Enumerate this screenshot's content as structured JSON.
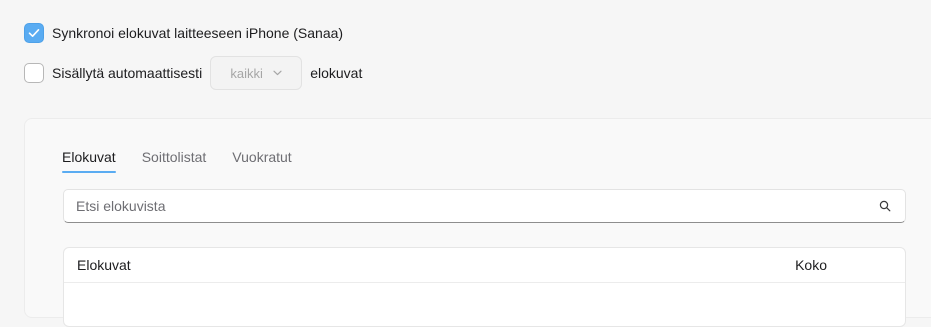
{
  "sync": {
    "checked": true,
    "label": "Synkronoi elokuvat laitteeseen iPhone (Sanaa)"
  },
  "auto_include": {
    "checked": false,
    "label_before": "Sisällytä automaattisesti",
    "select_value": "kaikki",
    "label_after": "elokuvat"
  },
  "tabs": [
    {
      "label": "Elokuvat",
      "active": true
    },
    {
      "label": "Soittolistat",
      "active": false
    },
    {
      "label": "Vuokratut",
      "active": false
    }
  ],
  "search": {
    "placeholder": "Etsi elokuvista",
    "icon": "search-icon"
  },
  "table": {
    "columns": [
      "Elokuvat",
      "Koko"
    ]
  },
  "colors": {
    "accent": "#5aacf2",
    "background": "#f6f6f6"
  }
}
